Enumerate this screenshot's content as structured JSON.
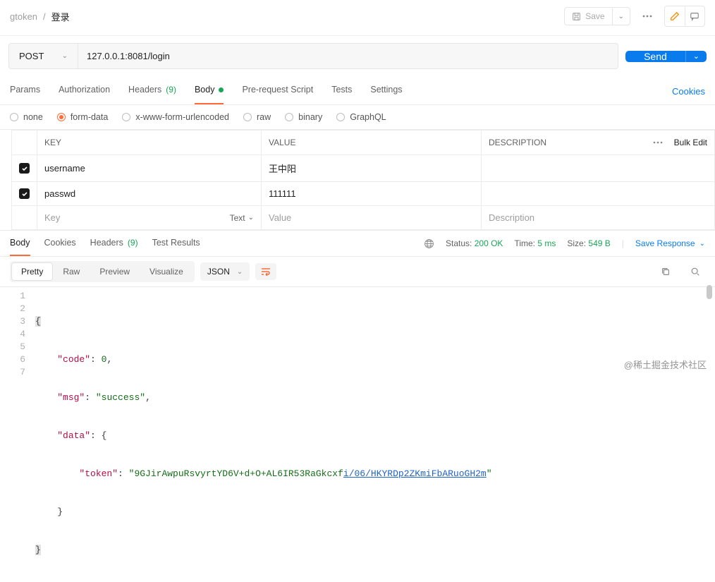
{
  "breadcrumb": {
    "parent": "gtoken",
    "sep": "/",
    "current": "登录"
  },
  "topbar": {
    "save_label": "Save"
  },
  "request": {
    "method": "POST",
    "url": "127.0.0.1:8081/login",
    "send_label": "Send"
  },
  "req_tabs": {
    "params": "Params",
    "auth": "Authorization",
    "headers": "Headers",
    "headers_count": "(9)",
    "body": "Body",
    "prereq": "Pre-request Script",
    "tests": "Tests",
    "settings": "Settings",
    "cookies": "Cookies"
  },
  "body_types": {
    "none": "none",
    "formdata": "form-data",
    "xwww": "x-www-form-urlencoded",
    "raw": "raw",
    "binary": "binary",
    "graphql": "GraphQL"
  },
  "kv": {
    "headers": {
      "key": "KEY",
      "value": "VALUE",
      "desc": "DESCRIPTION",
      "bulk": "Bulk Edit"
    },
    "rows": [
      {
        "key": "username",
        "value": "王中阳",
        "desc": ""
      },
      {
        "key": "passwd",
        "value": "111111",
        "desc": ""
      }
    ],
    "placeholder": {
      "key": "Key",
      "value": "Value",
      "desc": "Description",
      "type": "Text"
    }
  },
  "resp_tabs": {
    "body": "Body",
    "cookies": "Cookies",
    "headers": "Headers",
    "headers_count": "(9)",
    "tests": "Test Results"
  },
  "resp_meta": {
    "status_label": "Status:",
    "status_value": "200 OK",
    "time_label": "Time:",
    "time_value": "5 ms",
    "size_label": "Size:",
    "size_value": "549 B",
    "save_response": "Save Response"
  },
  "viewer": {
    "modes": {
      "pretty": "Pretty",
      "raw": "Raw",
      "preview": "Preview",
      "visualize": "Visualize"
    },
    "lang": "JSON"
  },
  "json_body": {
    "line1_open": "{",
    "code_key": "\"code\"",
    "code_val": "0",
    "msg_key": "\"msg\"",
    "msg_val": "\"success\"",
    "data_key": "\"data\"",
    "token_key": "\"token\"",
    "token_val_a": "\"9GJirAwpuRsvyrtYD6V+d+O+AL6IR53RaGkcxf",
    "token_val_link": "i/06/HKYRDp2ZKmiFbARuoGH2m",
    "token_val_b": "\"",
    "close_brace": "}"
  },
  "line_numbers": [
    "1",
    "2",
    "3",
    "4",
    "5",
    "6",
    "7"
  ],
  "watermark": "@稀土掘金技术社区"
}
